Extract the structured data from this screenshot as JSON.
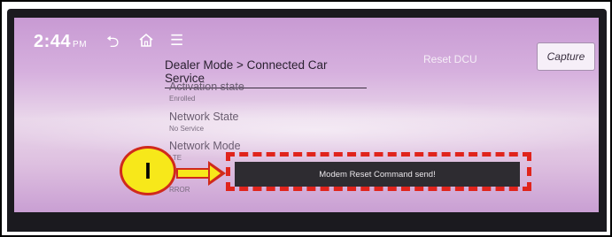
{
  "status_bar": {
    "time": "2:44",
    "time_suffix": "PM"
  },
  "nav_icons": [
    "back-icon",
    "home-icon",
    "menu-icon"
  ],
  "breadcrumb": "Dealer Mode > Connected Car Service",
  "reset_label": "Reset DCU",
  "capture_label": "Capture",
  "rows": [
    {
      "label": "Activation state",
      "value": "Enrolled"
    },
    {
      "label": "Network State",
      "value": "No Service"
    },
    {
      "label": "Network Mode",
      "value": "LTE"
    },
    {
      "label": "",
      "value": "RROR"
    }
  ],
  "toast_message": "Modem Reset Command send!",
  "callout_label": "I",
  "colors": {
    "highlight": "#e0241c",
    "callout_fill": "#f7e81a",
    "toast_bg": "#2e2c31"
  }
}
